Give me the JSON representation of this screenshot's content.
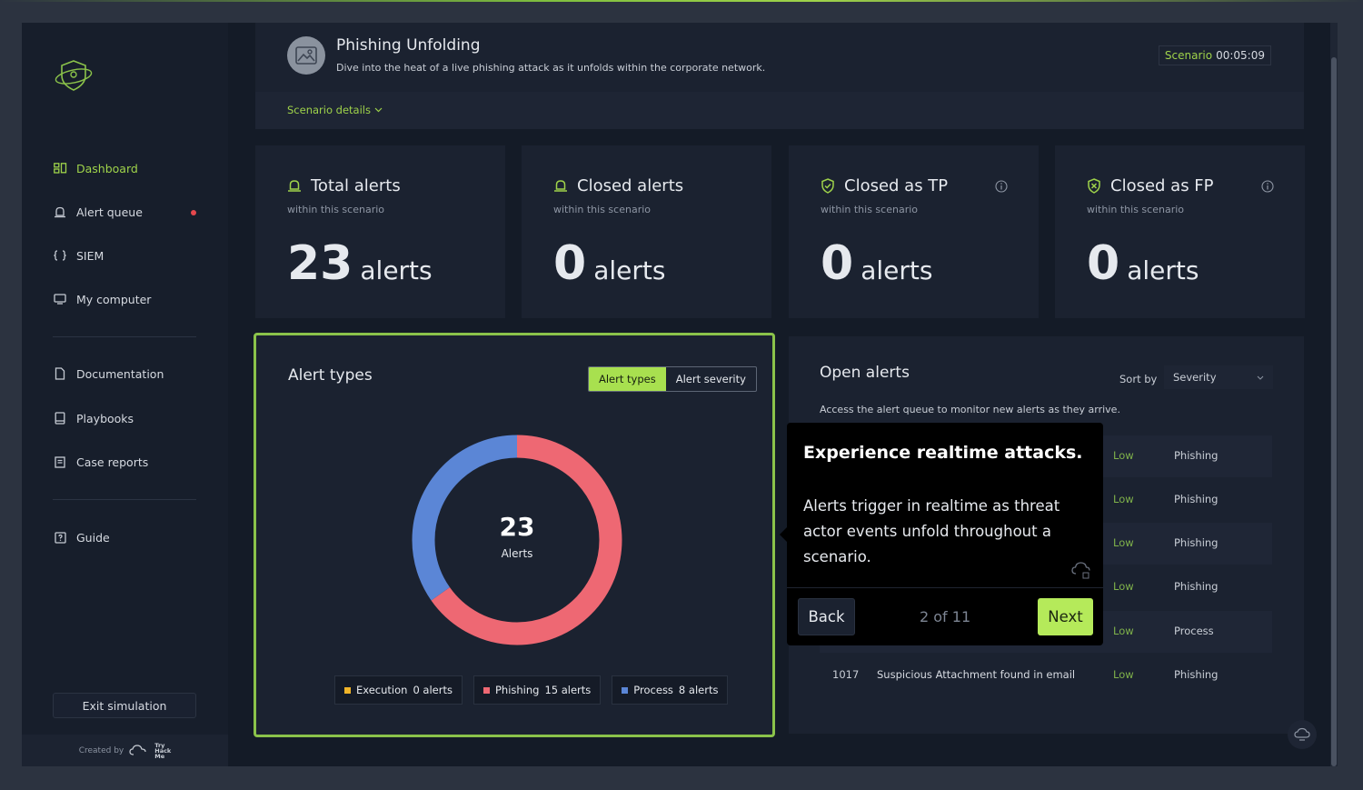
{
  "sidebar": {
    "items": [
      {
        "label": "Dashboard",
        "icon": "dashboard-icon",
        "active": true
      },
      {
        "label": "Alert queue",
        "icon": "alert-bell-icon"
      },
      {
        "label": "SIEM",
        "icon": "braces-icon"
      },
      {
        "label": "My computer",
        "icon": "monitor-icon"
      },
      {
        "label": "Documentation",
        "icon": "document-icon"
      },
      {
        "label": "Playbooks",
        "icon": "book-icon"
      },
      {
        "label": "Case reports",
        "icon": "report-icon"
      },
      {
        "label": "Guide",
        "icon": "help-square-icon"
      }
    ],
    "exit_label": "Exit simulation",
    "created_by": "Created by",
    "brand_text": [
      "Try",
      "Hack",
      "Me"
    ]
  },
  "scenario": {
    "title": "Phishing Unfolding",
    "description": "Dive into the heat of a live phishing attack as it unfolds within the corporate network.",
    "timer_label": "Scenario",
    "timer_value": "00:05:09",
    "details_label": "Scenario details"
  },
  "stats": [
    {
      "title": "Total alerts",
      "subtitle": "within this scenario",
      "value": "23",
      "unit": "alerts"
    },
    {
      "title": "Closed alerts",
      "subtitle": "within this scenario",
      "value": "0",
      "unit": "alerts"
    },
    {
      "title": "Closed as TP",
      "subtitle": "within this scenario",
      "value": "0",
      "unit": "alerts"
    },
    {
      "title": "Closed as FP",
      "subtitle": "within this scenario",
      "value": "0",
      "unit": "alerts"
    }
  ],
  "alert_types": {
    "title": "Alert types",
    "toggle": {
      "active": "Alert types",
      "inactive": "Alert severity"
    },
    "center_value": "23",
    "center_label": "Alerts",
    "legend": [
      {
        "name": "Execution",
        "count": "0 alerts",
        "color": "#f0b429"
      },
      {
        "name": "Phishing",
        "count": "15 alerts",
        "color": "#ee6873"
      },
      {
        "name": "Process",
        "count": "8 alerts",
        "color": "#5b86d6"
      }
    ]
  },
  "chart_data": {
    "type": "pie",
    "categories": [
      "Execution",
      "Phishing",
      "Process"
    ],
    "values": [
      0,
      15,
      8
    ],
    "colors": [
      "#f0b429",
      "#ee6873",
      "#5b86d6"
    ]
  },
  "open_alerts": {
    "title": "Open alerts",
    "description": "Access the alert queue to monitor new alerts as they arrive.",
    "sort_label": "Sort by",
    "sort_value": "Severity",
    "rows": [
      {
        "id": "",
        "desc": "",
        "severity": "Low",
        "type": "Phishing"
      },
      {
        "id": "",
        "desc": "",
        "severity": "Low",
        "type": "Phishing"
      },
      {
        "id": "",
        "desc": "",
        "severity": "Low",
        "type": "Phishing"
      },
      {
        "id": "",
        "desc": "",
        "severity": "Low",
        "type": "Phishing"
      },
      {
        "id": "",
        "desc": "",
        "severity": "Low",
        "type": "Process"
      },
      {
        "id": "1017",
        "desc": "Suspicious Attachment found in email",
        "severity": "Low",
        "type": "Phishing"
      }
    ]
  },
  "tour": {
    "title": "Experience realtime attacks.",
    "body": "Alerts trigger in realtime as threat actor events unfold throughout a scenario.",
    "back_label": "Back",
    "step": "2 of 11",
    "next_label": "Next"
  }
}
